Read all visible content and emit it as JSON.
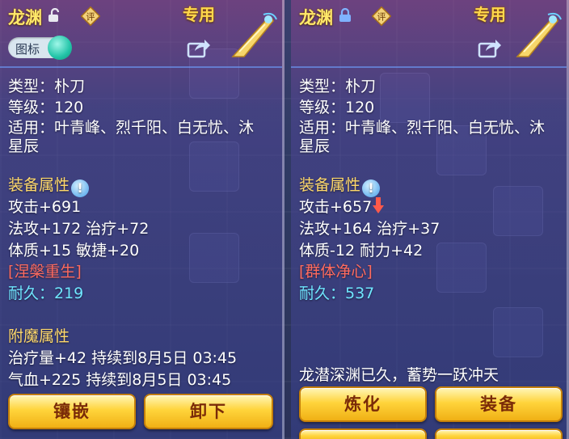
{
  "left_panel": {
    "item_name": "龙渊",
    "rate_glyph": "评",
    "exclusive_label": "专用",
    "icon_toggle_label": "图标",
    "lines": {
      "type": "类型：朴刀",
      "level": "等级：120",
      "usable1": "适用：叶青峰、烈千阳、白无忧、沐",
      "usable2": "星辰",
      "equip_attr_title": "装备属性",
      "attack": "攻击+691",
      "magic_heal": "法攻+172 治疗+72",
      "stats": "体质+15 敏捷+20",
      "special": "[涅槃重生]",
      "durability": "耐久：219",
      "enchant_title": "附魔属性",
      "enchant1": "治疗量+42 持续到8月5日 03:45",
      "enchant2": "气血+225 持续到8月5日 03:45"
    },
    "buttons": {
      "inlay": "镶嵌",
      "unequip": "卸下"
    }
  },
  "right_panel": {
    "item_name": "龙渊",
    "rate_glyph": "评",
    "exclusive_label": "专用",
    "lines": {
      "type": "类型：朴刀",
      "level": "等级：120",
      "usable1": "适用：叶青峰、烈千阳、白无忧、沐",
      "usable2": "星辰",
      "equip_attr_title": "装备属性",
      "attack": "攻击+657",
      "magic_heal": "法攻+164 治疗+37",
      "stats": "体质-12 耐力+42",
      "special": "[群体净心]",
      "durability": "耐久：537",
      "flavor": "龙潜深渊已久，蓄势一跃冲天"
    },
    "buttons": {
      "refine": "炼化",
      "equip": "装备"
    }
  },
  "colors": {
    "name": "#ffe96b",
    "section": "#ffd96a",
    "special": "#ff6b5f",
    "durability": "#6fe6ff",
    "button": "#ffd43b"
  }
}
